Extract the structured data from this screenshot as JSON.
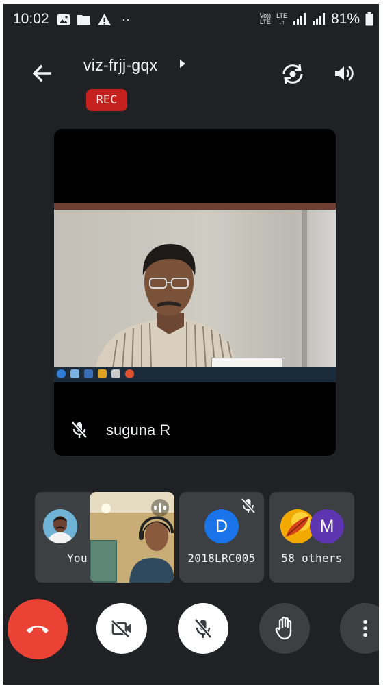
{
  "status_bar": {
    "time": "10:02",
    "more": "··",
    "volte": "Vo))",
    "lte_top": "LTE",
    "lte_bottom": "LTE",
    "arrows": "↓↑",
    "battery_pct": "81%"
  },
  "header": {
    "meeting_code": "viz-frjj-gqx",
    "rec_badge": "REC"
  },
  "main_tile": {
    "participant_name": "suguna R",
    "mic_state": "muted"
  },
  "participants": [
    {
      "label": "You",
      "muted": true
    },
    {
      "label": "",
      "speaking": true
    },
    {
      "label": "2018LRC005",
      "initial": "D",
      "avatar_color": "#1a73e8",
      "muted": true
    },
    {
      "label": "58 others",
      "initial": "M",
      "avatar_color": "#5e35b1"
    }
  ],
  "controls": {
    "end_call_color": "#ea4335",
    "items": [
      "end-call",
      "camera-off",
      "mic-off",
      "raise-hand",
      "more-options"
    ]
  },
  "colors": {
    "background": "#202124",
    "tile": "#3c4043",
    "rec": "#c5221f"
  }
}
